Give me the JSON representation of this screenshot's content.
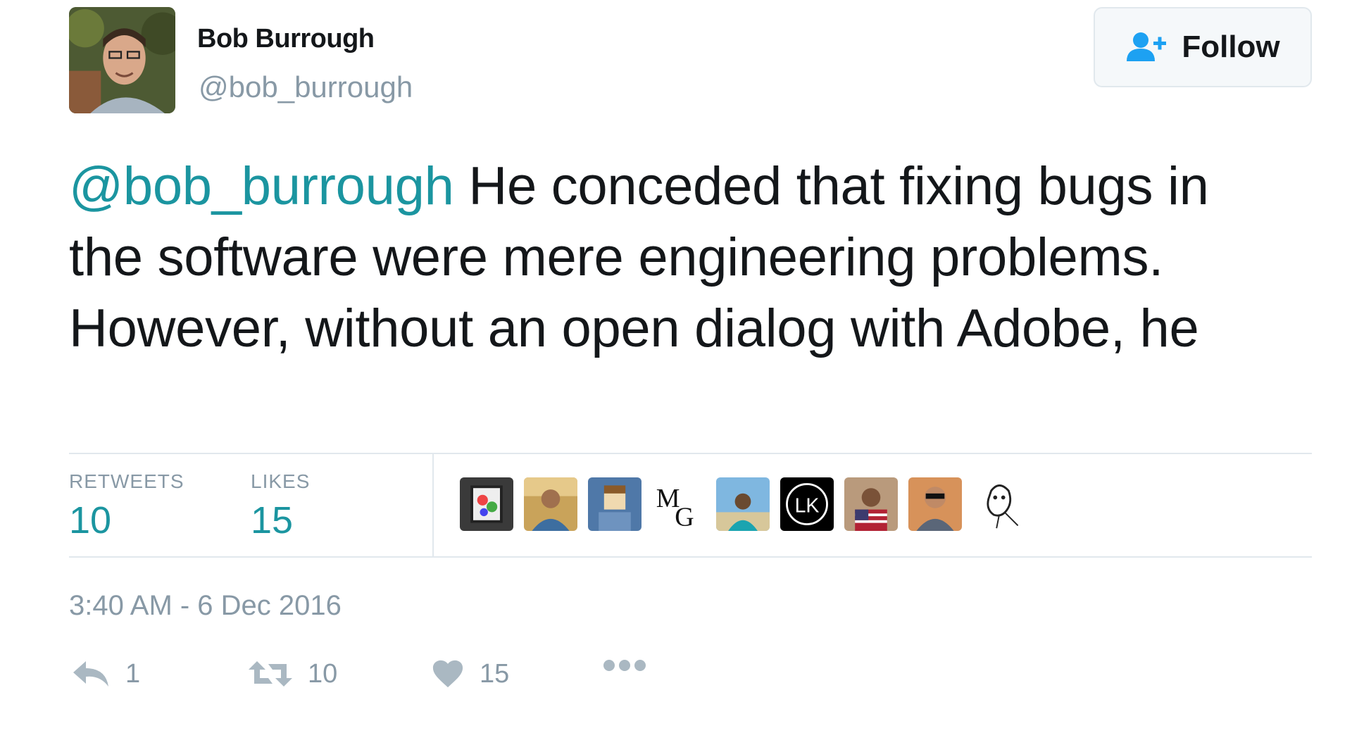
{
  "author": {
    "name": "Bob Burrough",
    "handle": "@bob_burrough"
  },
  "follow": {
    "label": "Follow",
    "icon": "follow-user-icon"
  },
  "tweet": {
    "mention": "@bob_burrough",
    "body": " He conceded that fixing bugs in the software were mere engineering problems. However, without an open dialog with Adobe, he"
  },
  "stats": {
    "retweets_label": "RETWEETS",
    "retweets_value": "10",
    "likes_label": "LIKES",
    "likes_value": "15"
  },
  "likers": [
    {
      "icon": "liker-avatar-art"
    },
    {
      "icon": "liker-avatar-photo"
    },
    {
      "icon": "liker-avatar-pixel"
    },
    {
      "icon": "liker-avatar-mg",
      "text_m": "M",
      "text_g": "G"
    },
    {
      "icon": "liker-avatar-beach"
    },
    {
      "icon": "liker-avatar-lk",
      "text": "LK"
    },
    {
      "icon": "liker-avatar-flag"
    },
    {
      "icon": "liker-avatar-sunglasses"
    },
    {
      "icon": "liker-avatar-sketch"
    }
  ],
  "timestamp": "3:40 AM - 6 Dec 2016",
  "actions": {
    "reply_count": "1",
    "retweet_count": "10",
    "like_count": "15"
  },
  "colors": {
    "accent": "#1b95a0",
    "muted": "#8899a6",
    "text": "#14171a",
    "follow_icon": "#1da1f2"
  }
}
